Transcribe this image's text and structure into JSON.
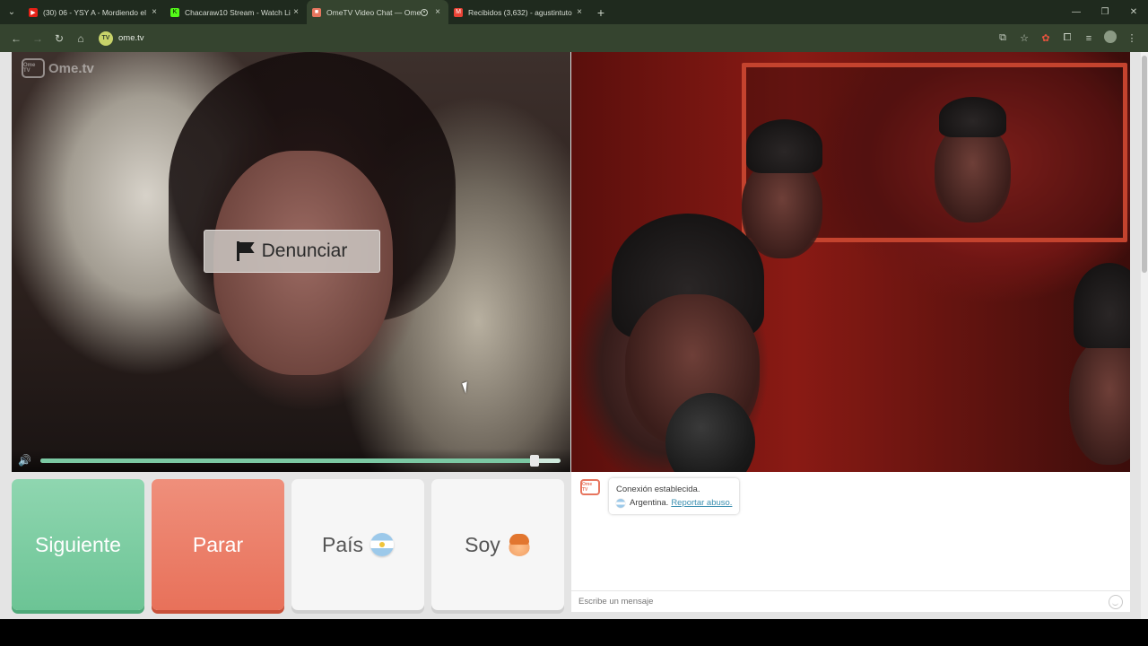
{
  "browser": {
    "tabs": [
      {
        "title": "(30) 06 - YSY A - Mordiendo el F",
        "favicon_color": "#e62117",
        "active": false
      },
      {
        "title": "Chacaraw10 Stream - Watch Li",
        "favicon_color": "#53fc18",
        "active": false
      },
      {
        "title": "OmeTV Video Chat — Ome",
        "favicon_color": "#e7755e",
        "active": true
      },
      {
        "title": "Recibidos (3,632) - agustintuto",
        "favicon_color": "#ea4335",
        "active": false
      }
    ],
    "url": "ome.tv"
  },
  "icons": {
    "back": "←",
    "forward": "→",
    "reload": "↻",
    "home": "⌂",
    "new_tab": "+",
    "tab_close": "×",
    "menu": "⌄",
    "window_min": "—",
    "window_max": "❐",
    "window_close": "✕",
    "cast": "⧉",
    "bookmark": "☆",
    "extension": "✿",
    "puzzle": "⧠",
    "media": "≡",
    "more": "⋮",
    "volume": "🔊"
  },
  "app": {
    "logo_text": "Ome.tv",
    "logo_tv": "Ome TV",
    "report_button": "Denunciar",
    "volume_level": 0.95,
    "buttons": {
      "next": "Siguiente",
      "stop": "Parar",
      "country": "País",
      "gender": "Soy"
    }
  },
  "chat": {
    "status_message": "Conexión establecida.",
    "country": "Argentina.",
    "report_link": "Reportar abuso.",
    "input_placeholder": "Escribe un mensaje"
  },
  "colors": {
    "next": "#6cc495",
    "stop": "#e8715a",
    "link": "#3b8fb0",
    "chrome": "#35442f"
  }
}
